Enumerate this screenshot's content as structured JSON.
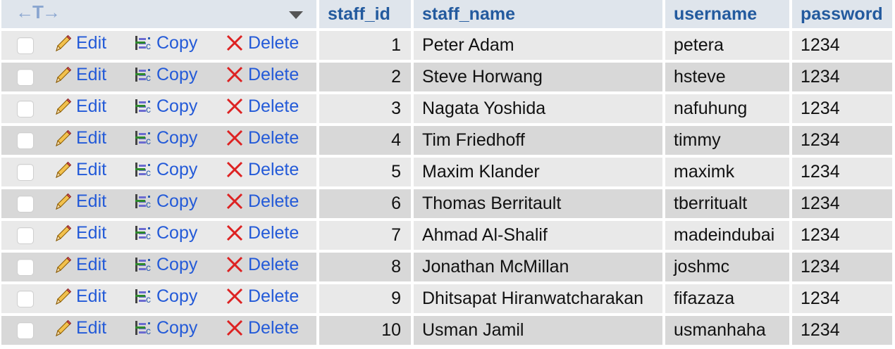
{
  "header": {
    "arrows": "←T→",
    "columns": [
      "staff_id",
      "staff_name",
      "username",
      "password"
    ]
  },
  "actions": {
    "edit": "Edit",
    "copy": "Copy",
    "delete": "Delete"
  },
  "rows": [
    {
      "staff_id": "1",
      "staff_name": "Peter Adam",
      "username": "petera",
      "password": "1234"
    },
    {
      "staff_id": "2",
      "staff_name": "Steve Horwang",
      "username": "hsteve",
      "password": "1234"
    },
    {
      "staff_id": "3",
      "staff_name": "Nagata Yoshida",
      "username": "nafuhung",
      "password": "1234"
    },
    {
      "staff_id": "4",
      "staff_name": "Tim Friedhoff",
      "username": "timmy",
      "password": "1234"
    },
    {
      "staff_id": "5",
      "staff_name": "Maxim Klander",
      "username": "maximk",
      "password": "1234"
    },
    {
      "staff_id": "6",
      "staff_name": "Thomas Berritault",
      "username": "tberritualt",
      "password": "1234"
    },
    {
      "staff_id": "7",
      "staff_name": "Ahmad Al-Shalif",
      "username": "madeindubai",
      "password": "1234"
    },
    {
      "staff_id": "8",
      "staff_name": "Jonathan McMillan",
      "username": "joshmc",
      "password": "1234"
    },
    {
      "staff_id": "9",
      "staff_name": "Dhitsapat Hiranwatcharakan",
      "username": "fifazaza",
      "password": "1234"
    },
    {
      "staff_id": "10",
      "staff_name": "Usman Jamil",
      "username": "usmanhaha",
      "password": "1234"
    }
  ]
}
